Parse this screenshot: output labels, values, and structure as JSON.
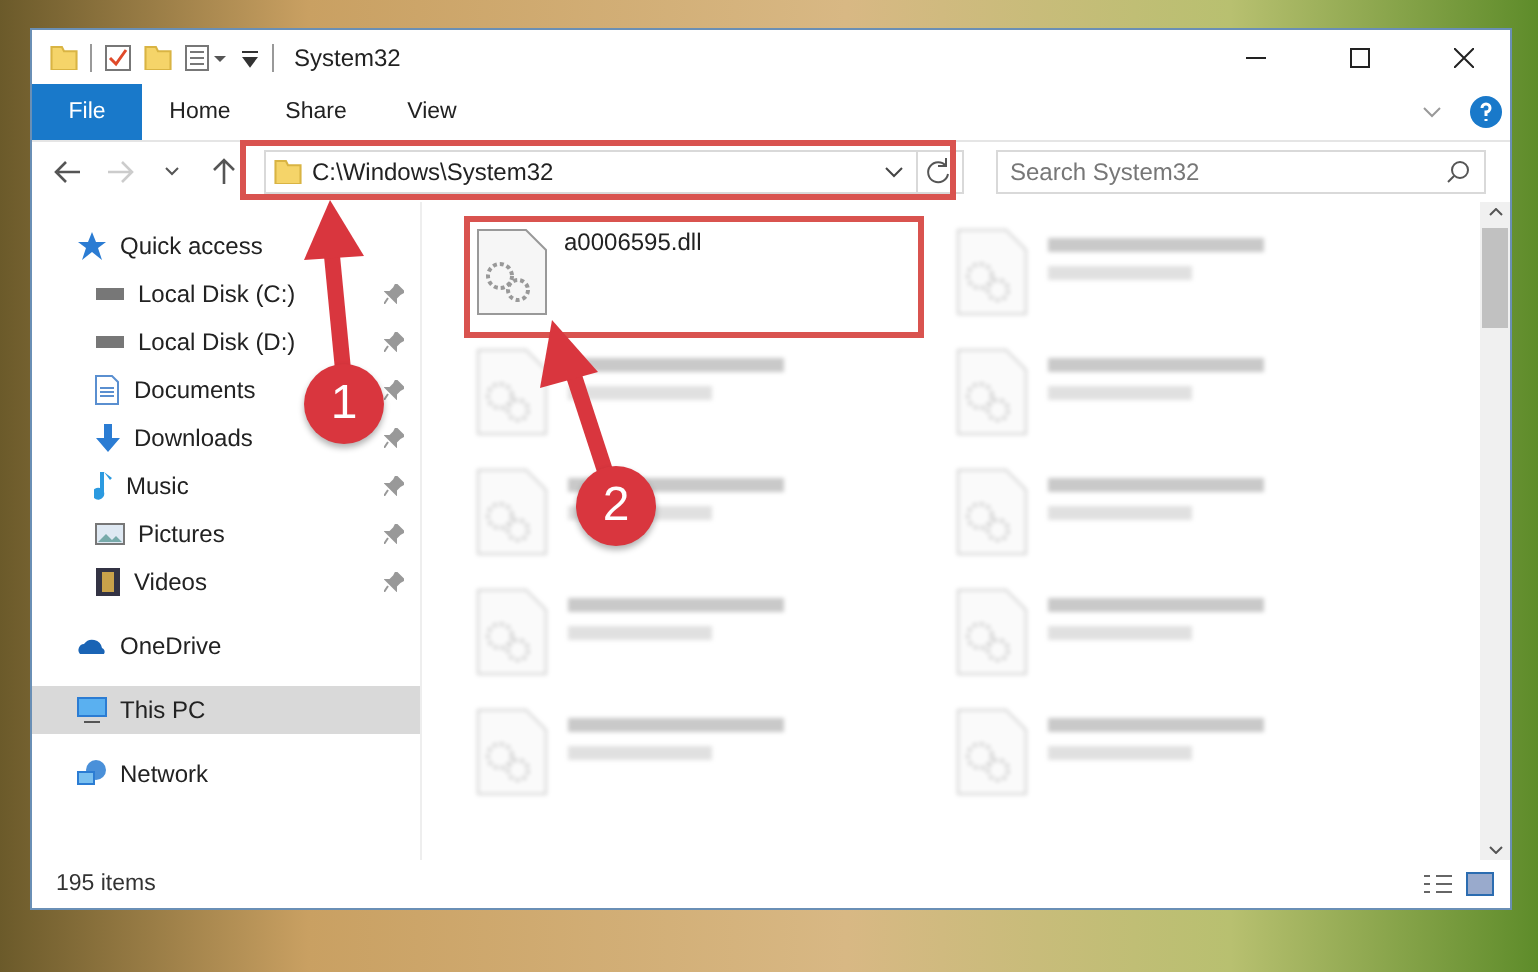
{
  "window": {
    "title": "System32"
  },
  "ribbon_tabs": [
    {
      "label": "File",
      "selected": true
    },
    {
      "label": "Home",
      "selected": false
    },
    {
      "label": "Share",
      "selected": false
    },
    {
      "label": "View",
      "selected": false
    }
  ],
  "address": {
    "path": "C:\\Windows\\System32"
  },
  "search": {
    "placeholder": "Search System32"
  },
  "sidebar": {
    "items": [
      {
        "label": "Quick access",
        "kind": "star",
        "selected": false,
        "children": [
          {
            "label": "Local Disk (C:)",
            "kind": "drive",
            "pinned": true,
            "selected": false
          },
          {
            "label": "Local Disk (D:)",
            "kind": "drive",
            "pinned": true,
            "selected": false
          },
          {
            "label": "Documents",
            "kind": "document",
            "pinned": true,
            "selected": false
          },
          {
            "label": "Downloads",
            "kind": "download",
            "pinned": true,
            "selected": false
          },
          {
            "label": "Music",
            "kind": "music",
            "pinned": true,
            "selected": false
          },
          {
            "label": "Pictures",
            "kind": "picture",
            "pinned": true,
            "selected": false
          },
          {
            "label": "Videos",
            "kind": "video",
            "pinned": true,
            "selected": false
          }
        ]
      },
      {
        "label": "OneDrive",
        "kind": "cloud",
        "selected": false
      },
      {
        "label": "This PC",
        "kind": "computer",
        "selected": true
      },
      {
        "label": "Network",
        "kind": "network",
        "selected": false
      }
    ]
  },
  "files": [
    {
      "kind": "file",
      "name": "a0006595.dll"
    },
    {
      "kind": "blurred"
    },
    {
      "kind": "blurred"
    },
    {
      "kind": "blurred"
    },
    {
      "kind": "blurred"
    },
    {
      "kind": "blurred"
    },
    {
      "kind": "blurred"
    },
    {
      "kind": "blurred"
    },
    {
      "kind": "blurred"
    },
    {
      "kind": "blurred"
    }
  ],
  "status_bar": {
    "count": "195 items"
  },
  "annotations": [
    {
      "number": "1"
    },
    {
      "number": "2"
    }
  ]
}
